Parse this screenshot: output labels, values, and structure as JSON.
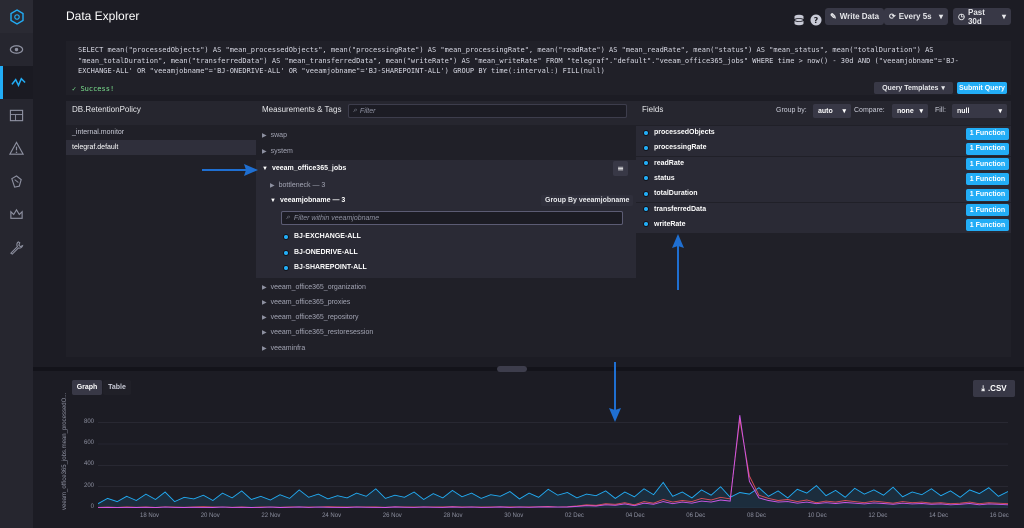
{
  "header": {
    "title": "Data Explorer",
    "write_data_label": "Write Data",
    "refresh_label": "Every 5s",
    "time_range_label": "Past 30d"
  },
  "query": {
    "lines": [
      [
        "kw",
        "SELECT "
      ],
      [
        "fn",
        "mean"
      ],
      [
        "t",
        "(\"processedObjects\") "
      ],
      [
        "kw",
        "AS "
      ],
      [
        "t",
        "\"mean_processedObjects\", "
      ],
      [
        "fn",
        "mean"
      ],
      [
        "t",
        "(\"processingRate\") "
      ],
      [
        "kw",
        "AS "
      ],
      [
        "t",
        "\"mean_processingRate\", "
      ],
      [
        "fn",
        "mean"
      ],
      [
        "t",
        "(\"readRate\") "
      ],
      [
        "kw",
        "AS "
      ],
      [
        "t",
        "\"mean_readRate\", "
      ],
      [
        "fn",
        "mean"
      ],
      [
        "t",
        "(\"status\") "
      ],
      [
        "kw",
        "AS "
      ],
      [
        "t",
        "\"mean_status\", "
      ],
      [
        "fn",
        "mean"
      ],
      [
        "t",
        "(\"totalDuration\") "
      ],
      [
        "kw",
        "AS"
      ]
    ],
    "text_line1": "SELECT mean(\"processedObjects\") AS \"mean_processedObjects\", mean(\"processingRate\") AS \"mean_processingRate\", mean(\"readRate\") AS \"mean_readRate\", mean(\"status\") AS \"mean_status\", mean(\"totalDuration\") AS",
    "text_line2": "\"mean_totalDuration\", mean(\"transferredData\") AS \"mean_transferredData\", mean(\"writeRate\") AS \"mean_writeRate\" FROM \"telegraf\".\"default\".\"veeam_office365_jobs\" WHERE time > now() - 30d AND (\"veeamjobname\"='BJ-",
    "text_line3": "EXCHANGE-ALL' OR \"veeamjobname\"='BJ-ONEDRIVE-ALL' OR \"veeamjobname\"='BJ-SHAREPOINT-ALL') GROUP BY time(:interval:) FILL(null)",
    "status": "Success!",
    "templates_label": "Query Templates",
    "submit_label": "Submit Query"
  },
  "schema": {
    "db_header": "DB.RetentionPolicy",
    "meas_header": "Measurements & Tags",
    "filter_placeholder": "Filter",
    "fields_header": "Fields",
    "databases": [
      "_internal.monitor",
      "telegraf.default"
    ],
    "measurements_top": [
      "swap",
      "system"
    ],
    "expanded_measurement": "veeam_office365_jobs",
    "tag_collapsed": "bottleneck — 3",
    "tag_expanded": "veeamjobname — 3",
    "group_by_label": "Group By veeamjobname",
    "tag_filter_placeholder": "Filter within veeamjobname",
    "tag_values": [
      "BJ-EXCHANGE-ALL",
      "BJ-ONEDRIVE-ALL",
      "BJ-SHAREPOINT-ALL"
    ],
    "measurements_bottom": [
      "veeam_office365_organization",
      "veeam_office365_proxies",
      "veeam_office365_repository",
      "veeam_office365_restoresession",
      "veeaminfra"
    ],
    "group_by": {
      "label": "Group by:",
      "value": "auto"
    },
    "compare": {
      "label": "Compare:",
      "value": "none"
    },
    "fill": {
      "label": "Fill:",
      "value": "null"
    },
    "fields": [
      "processedObjects",
      "processingRate",
      "readRate",
      "status",
      "totalDuration",
      "transferredData",
      "writeRate"
    ],
    "function_label": "1 Function"
  },
  "graph": {
    "tab_graph": "Graph",
    "tab_table": "Table",
    "csv_label": ".CSV",
    "ylabel": "veeam_office365_jobs.mean_processedO..."
  },
  "chart_data": {
    "type": "line",
    "x_ticks": [
      "18 Nov",
      "20 Nov",
      "22 Nov",
      "24 Nov",
      "26 Nov",
      "28 Nov",
      "30 Nov",
      "02 Dec",
      "04 Dec",
      "06 Dec",
      "08 Dec",
      "10 Dec",
      "12 Dec",
      "14 Dec",
      "16 Dec"
    ],
    "y_ticks": [
      0,
      200,
      400,
      600,
      800
    ],
    "ylim": [
      0,
      900
    ],
    "series": [
      {
        "color": "#22adf6",
        "values": [
          40,
          90,
          60,
          110,
          70,
          130,
          80,
          150,
          60,
          100,
          85,
          120,
          70,
          140,
          95,
          160,
          80,
          110,
          75,
          125,
          90,
          170,
          100,
          130,
          85,
          115,
          95,
          140,
          110,
          180,
          90,
          120,
          100,
          150,
          80,
          135,
          95,
          165,
          105,
          140,
          90,
          125,
          110,
          155,
          85,
          140,
          100,
          175,
          120,
          145,
          95,
          130,
          115,
          160,
          90,
          150,
          105,
          180,
          125,
          240,
          110,
          150,
          95,
          170,
          120,
          200,
          100,
          145,
          130,
          190,
          110,
          160,
          95,
          175,
          140,
          210,
          115,
          165,
          100,
          185,
          130,
          170,
          120,
          195,
          105,
          150,
          125,
          180,
          115,
          160,
          100,
          170,
          135,
          190,
          110,
          155
        ]
      },
      {
        "color": "#dc4e58",
        "values": [
          5,
          8,
          6,
          10,
          7,
          9,
          6,
          11,
          8,
          7,
          9,
          12,
          8,
          10,
          7,
          9,
          6,
          8,
          10,
          7,
          9,
          11,
          8,
          10,
          12,
          9,
          8,
          11,
          10,
          9,
          7,
          12,
          10,
          8,
          11,
          9,
          10,
          13,
          9,
          11,
          8,
          10,
          12,
          9,
          11,
          10,
          12,
          14,
          10,
          12,
          20,
          30,
          25,
          40,
          35,
          50,
          30,
          60,
          45,
          80,
          55,
          70,
          60,
          90,
          75,
          100,
          85,
          830,
          300,
          120,
          90,
          70,
          80,
          60,
          75,
          50,
          65,
          55,
          70,
          60,
          50,
          65,
          55,
          45,
          60,
          50,
          55,
          45,
          50,
          40,
          45,
          55,
          40,
          50,
          45,
          40
        ]
      },
      {
        "color": "#ce58eb",
        "values": [
          3,
          5,
          4,
          6,
          5,
          7,
          4,
          8,
          6,
          5,
          7,
          6,
          5,
          8,
          6,
          7,
          5,
          6,
          8,
          5,
          7,
          9,
          6,
          8,
          7,
          6,
          5,
          8,
          7,
          6,
          5,
          9,
          7,
          6,
          8,
          7,
          6,
          9,
          7,
          8,
          6,
          7,
          9,
          6,
          8,
          7,
          9,
          10,
          8,
          9,
          15,
          22,
          18,
          30,
          25,
          38,
          22,
          45,
          35,
          60,
          40,
          55,
          45,
          65,
          55,
          75,
          65,
          870,
          250,
          95,
          70,
          55,
          60,
          45,
          55,
          40,
          50,
          42,
          52,
          45,
          38,
          48,
          42,
          35,
          45,
          38,
          42,
          35,
          38,
          30,
          35,
          42,
          30,
          38,
          35,
          30
        ]
      }
    ]
  }
}
